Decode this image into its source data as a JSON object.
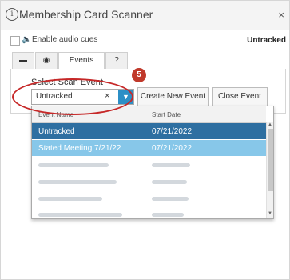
{
  "window": {
    "title": "Membership Card Scanner",
    "close_label": "×"
  },
  "audio": {
    "label": "Enable audio cues",
    "checked": false
  },
  "status": {
    "text": "Untracked"
  },
  "tabs": [
    {
      "icon": "card-icon",
      "glyph": "▬",
      "label": ""
    },
    {
      "icon": "camera-icon",
      "glyph": "◉",
      "label": ""
    },
    {
      "icon": "",
      "glyph": "",
      "label": "Events"
    },
    {
      "icon": "help-icon",
      "glyph": "?",
      "label": ""
    }
  ],
  "scan": {
    "label": "Select Scan Event",
    "selected": "Untracked",
    "clear_glyph": "×",
    "create_button": "Create New Event",
    "close_button": "Close Event"
  },
  "dropdown": {
    "columns": [
      "Event Name",
      "Start Date"
    ],
    "rows": [
      {
        "name": "Untracked",
        "date": "07/21/2022",
        "state": "selected"
      },
      {
        "name": "Stated Meeting 7/21/22",
        "date": "07/21/2022",
        "state": "highlighted"
      }
    ]
  },
  "annotation": {
    "step": "5",
    "color": "#c62828"
  },
  "colors": {
    "accent": "#2c8fc6",
    "selected_row": "#2e6fa1",
    "hover_row": "#87c7e9"
  }
}
